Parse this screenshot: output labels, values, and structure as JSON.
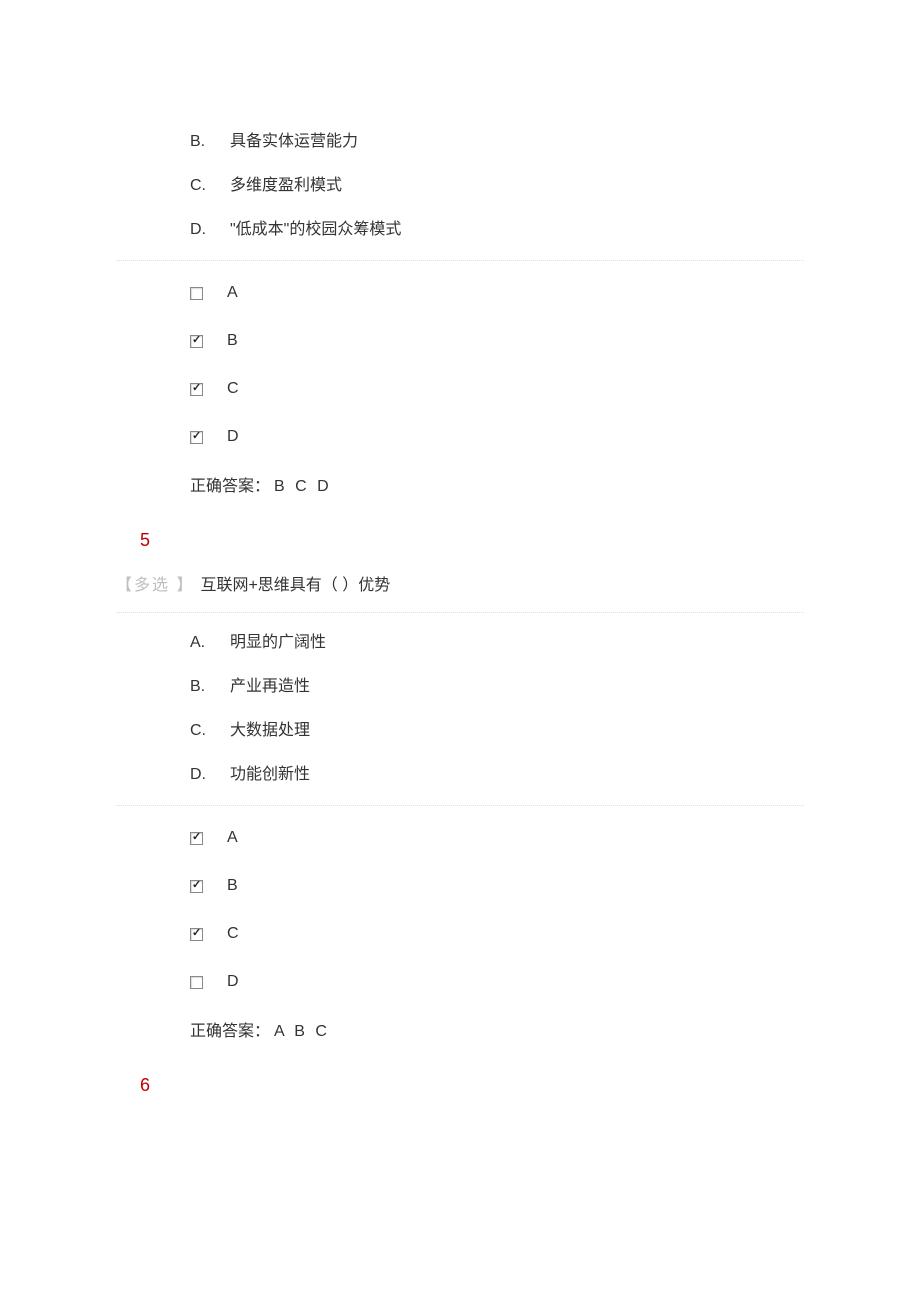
{
  "q4": {
    "options": [
      {
        "letter": "B.",
        "text": "具备实体运营能力"
      },
      {
        "letter": "C.",
        "text": "多维度盈利模式"
      },
      {
        "letter": "D.",
        "text": "\"低成本\"的校园众筹模式"
      }
    ],
    "answers": [
      {
        "letter": "A",
        "checked": false
      },
      {
        "letter": "B",
        "checked": true
      },
      {
        "letter": "C",
        "checked": true
      },
      {
        "letter": "D",
        "checked": true
      }
    ],
    "correct_label": "正确答案：",
    "correct_value": "B C D"
  },
  "q5": {
    "number": "5",
    "type_label": "【多选 】",
    "stem": "互联网+思维具有（ ）优势",
    "options": [
      {
        "letter": "A.",
        "text": "明显的广阔性"
      },
      {
        "letter": "B.",
        "text": "产业再造性"
      },
      {
        "letter": "C.",
        "text": "大数据处理"
      },
      {
        "letter": "D.",
        "text": "功能创新性"
      }
    ],
    "answers": [
      {
        "letter": "A",
        "checked": true
      },
      {
        "letter": "B",
        "checked": true
      },
      {
        "letter": "C",
        "checked": true
      },
      {
        "letter": "D",
        "checked": false
      }
    ],
    "correct_label": "正确答案：",
    "correct_value": "A B C"
  },
  "q6": {
    "number": "6"
  }
}
